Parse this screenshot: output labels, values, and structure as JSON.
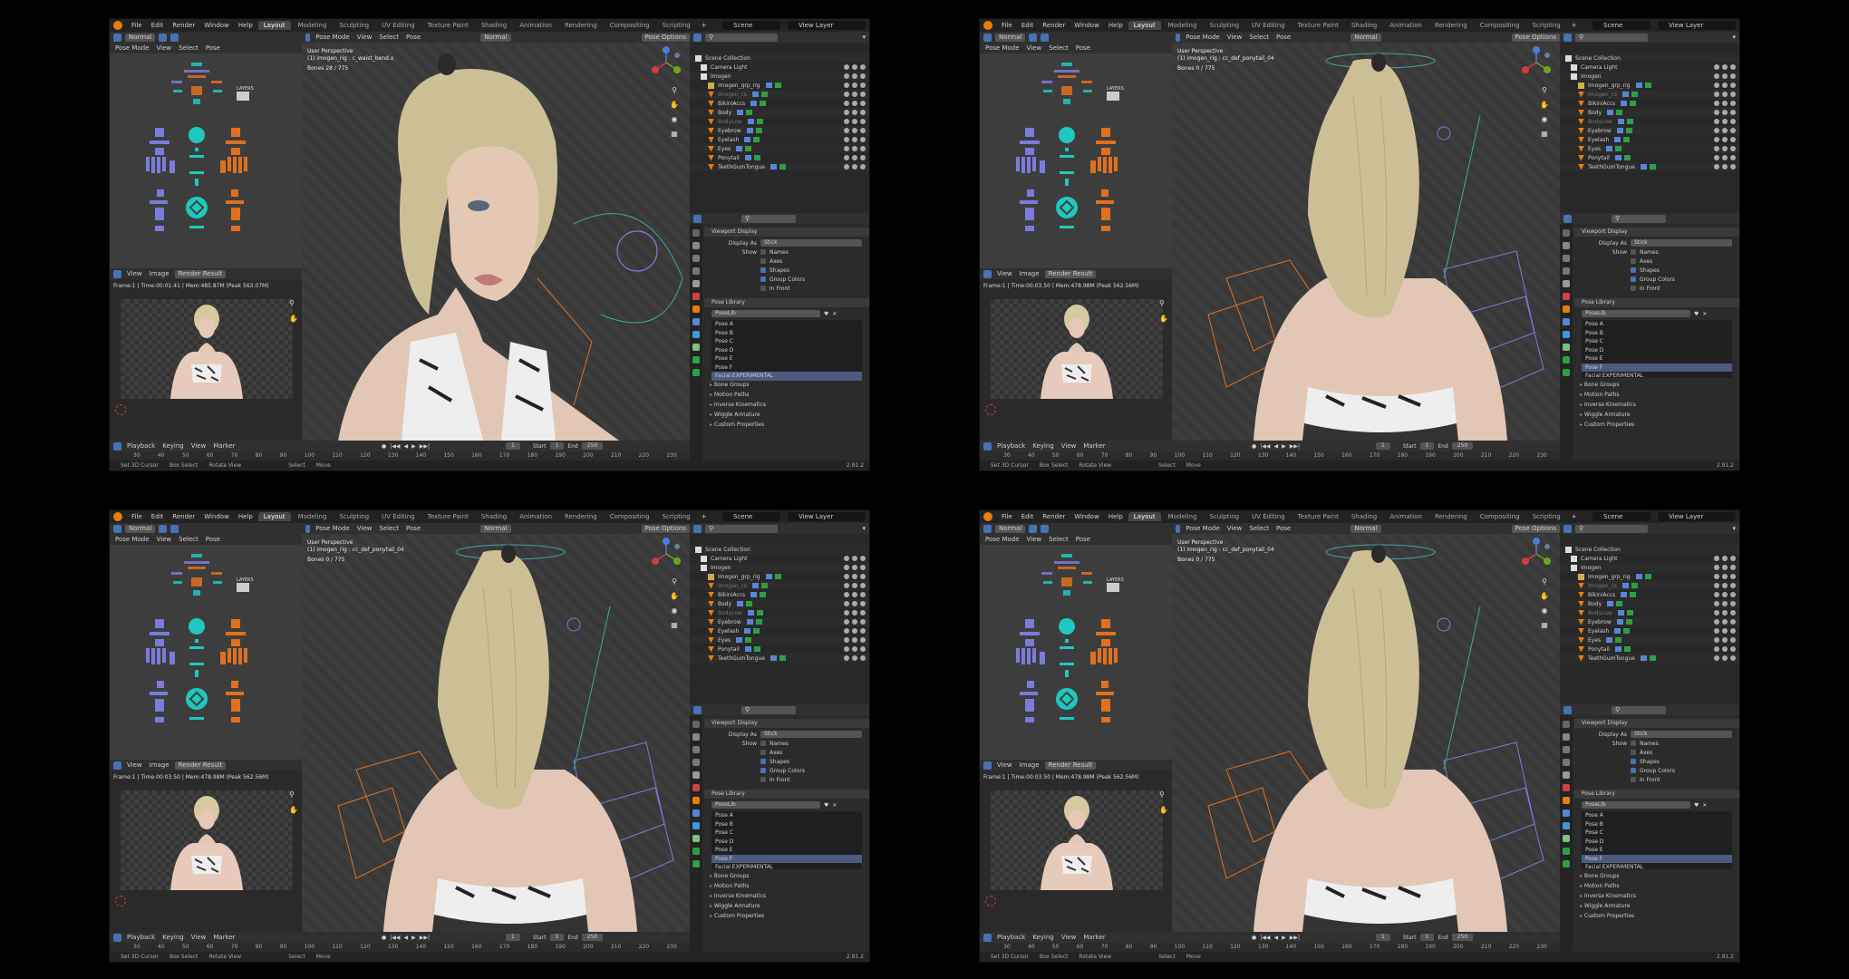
{
  "app": {
    "menus": [
      "File",
      "Edit",
      "Render",
      "Window",
      "Help"
    ],
    "workspaces": [
      "Layout",
      "Modeling",
      "Sculpting",
      "UV Editing",
      "Texture Paint",
      "Shading",
      "Animation",
      "Rendering",
      "Compositing",
      "Scripting"
    ],
    "active_workspace": "Layout",
    "scene": "Scene",
    "view_layer": "View Layer"
  },
  "headers": {
    "mode": "Pose Mode",
    "view": "View",
    "select": "Select",
    "pose": "Pose",
    "transform_orientation": "Normal",
    "pose_options": "Pose Options",
    "image_view": "View",
    "image_menu": "Image",
    "render_result": "Render Result"
  },
  "outliner": {
    "rows": [
      "Scene Collection",
      "Camera Light",
      "Imogen",
      "Imogen_grp_rig",
      "Imogen_cs",
      "BikiniAccs",
      "Body",
      "BodyLow",
      "Eyebrow",
      "Eyelash",
      "Eyes",
      "Ponytail",
      "TeethGumTongue"
    ]
  },
  "properties": {
    "viewport_display": "Viewport Display",
    "display_as_label": "Display As",
    "display_as_value": "Stick",
    "show_label": "Show",
    "show_items": [
      "Names",
      "Axes",
      "Shapes",
      "Group Colors",
      "In Front"
    ],
    "show_checked": [
      false,
      false,
      true,
      true,
      false
    ],
    "pose_library": "Pose Library",
    "poselib_name": "PoseLib",
    "poses": [
      "Pose A",
      "Pose B",
      "Pose C",
      "Pose D",
      "Pose E",
      "Pose F",
      "Facial EXPERIMENTAL"
    ],
    "subpanels": [
      "Bone Groups",
      "Motion Paths",
      "Inverse Kinematics",
      "Wiggle Armature",
      "Custom Properties"
    ]
  },
  "timeline": {
    "playback": "Playback",
    "keying": "Keying",
    "view": "View",
    "marker": "Marker",
    "current_frame": "1",
    "start_label": "Start",
    "start": "1",
    "end_label": "End",
    "end": "250",
    "ruler": [
      "30",
      "40",
      "50",
      "60",
      "70",
      "80",
      "90",
      "100",
      "110",
      "120",
      "130",
      "140",
      "150",
      "160",
      "170",
      "180",
      "190",
      "200",
      "210",
      "220",
      "230"
    ]
  },
  "statusbar": {
    "items": [
      "Set 3D Cursor",
      "Box Select",
      "Rotate View",
      "Select",
      "Move"
    ],
    "version": "2.91.2"
  },
  "rig_picker": {
    "layers_label": "LAYERS"
  },
  "panels": [
    {
      "viewport_title": "User Perspective",
      "active_bone": "(1) imogen_rig : c_waist_bend.x",
      "bones": "Bones      28 / 775",
      "render_info": "Frame:1 | Time:00:01.41 | Mem:485.87M (Peak 563.07M)",
      "selected_pose": 6
    },
    {
      "viewport_title": "User Perspective",
      "active_bone": "(1) imogen_rig : cc_def_ponytail_04",
      "bones": "Bones      0 / 775",
      "render_info": "Frame:1 | Time:00:03.50 | Mem:478.98M (Peak 562.56M)",
      "selected_pose": 5
    },
    {
      "viewport_title": "User Perspective",
      "active_bone": "(1) imogen_rig : cc_def_ponytail_04",
      "bones": "Bones      0 / 775",
      "render_info": "Frame:1 | Time:00:03.50 | Mem:478.98M (Peak 562.56M)",
      "selected_pose": 5
    },
    {
      "viewport_title": "User Perspective",
      "active_bone": "(1) imogen_rig : cc_def_ponytail_04",
      "bones": "Bones      0 / 775",
      "render_info": "Frame:1 | Time:00:03.50 | Mem:478.98M (Peak 562.56M)",
      "selected_pose": 5
    }
  ],
  "colors": {
    "bone_blue": "#7b7bdc",
    "bone_cyan": "#1ec8c0",
    "bone_orange": "#e07020",
    "select_blue": "#4772b3",
    "logo_orange": "#e87d0d"
  }
}
